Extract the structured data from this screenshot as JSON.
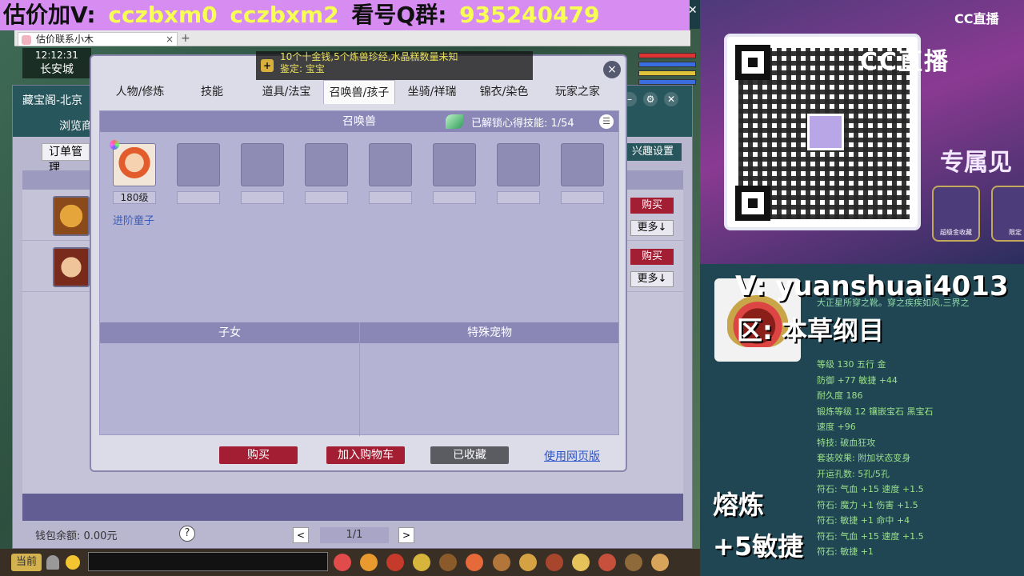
{
  "banner": {
    "part1": "估价加V:",
    "part2": "cczbxm0",
    "part3": "cczbxm2",
    "part4": "看号Q群:",
    "part5": "935240479"
  },
  "browser_tab": {
    "label": "估价联系小木"
  },
  "hud": {
    "time": "12:12:31",
    "city": "长安城"
  },
  "back_window": {
    "title": "藏宝阁-北京",
    "subtitle": "浏览商",
    "order_button": "订单管理",
    "fun_settings_button": "兴趣设置",
    "side_buy": "购买",
    "side_more": "更多↓",
    "wallet": "钱包余额: 0.00元",
    "help": "?",
    "pager": "1/1",
    "prev": "<",
    "next": ">"
  },
  "notice": {
    "line1": "10个十金钱,5个炼兽珍经,水晶糕数量未知",
    "line2": "鉴定: 宝宝"
  },
  "dialog": {
    "close": "×",
    "tabs": [
      "人物/修炼",
      "技能",
      "道具/法宝",
      "召唤兽/孩子",
      "坐骑/祥瑞",
      "锦衣/染色",
      "玩家之家"
    ],
    "active_tab": 3,
    "panel_title": "召唤兽",
    "skill_info": "已解锁心得技能: 1/54",
    "pet": {
      "level": "180级",
      "name": "进阶童子"
    },
    "children_header": "子女",
    "special_pet_header": "特殊宠物",
    "buttons": {
      "buy": "购买",
      "add_cart": "加入购物车",
      "favorited": "已收藏",
      "web_version": "使用网页版"
    }
  },
  "taskbar": {
    "current": "当前"
  },
  "stream": {
    "cc_logo": "CC直播",
    "cc_big": "CC直播",
    "exclusive": "专属见",
    "badge1": "超级金收藏",
    "badge2": "限定"
  },
  "info": {
    "v_line": "V: yuanshuai4013",
    "zone_line": "区: 本草纲目",
    "desc": "大正星所穿之靴。穿之疾疾如风,三界之",
    "stats": [
      "等级 130 五行 金",
      "",
      "防御 +77 敏捷 +44",
      "耐久度 186",
      "锻炼等级 12 镶嵌宝石 黑宝石",
      "速度 +96",
      "特技: 破血狂攻",
      "套装效果: 附加状态变身",
      "开运孔数: 5孔/5孔",
      "符石: 气血 +15 速度 +1.5",
      "符石: 魔力 +1 伤害 +1.5",
      "符石: 敏捷 +1 命中 +4",
      "符石: 气血 +15 速度 +1.5",
      "符石: 敏捷 +1"
    ],
    "smelt1": "熔炼",
    "smelt2": "+5敏捷"
  }
}
